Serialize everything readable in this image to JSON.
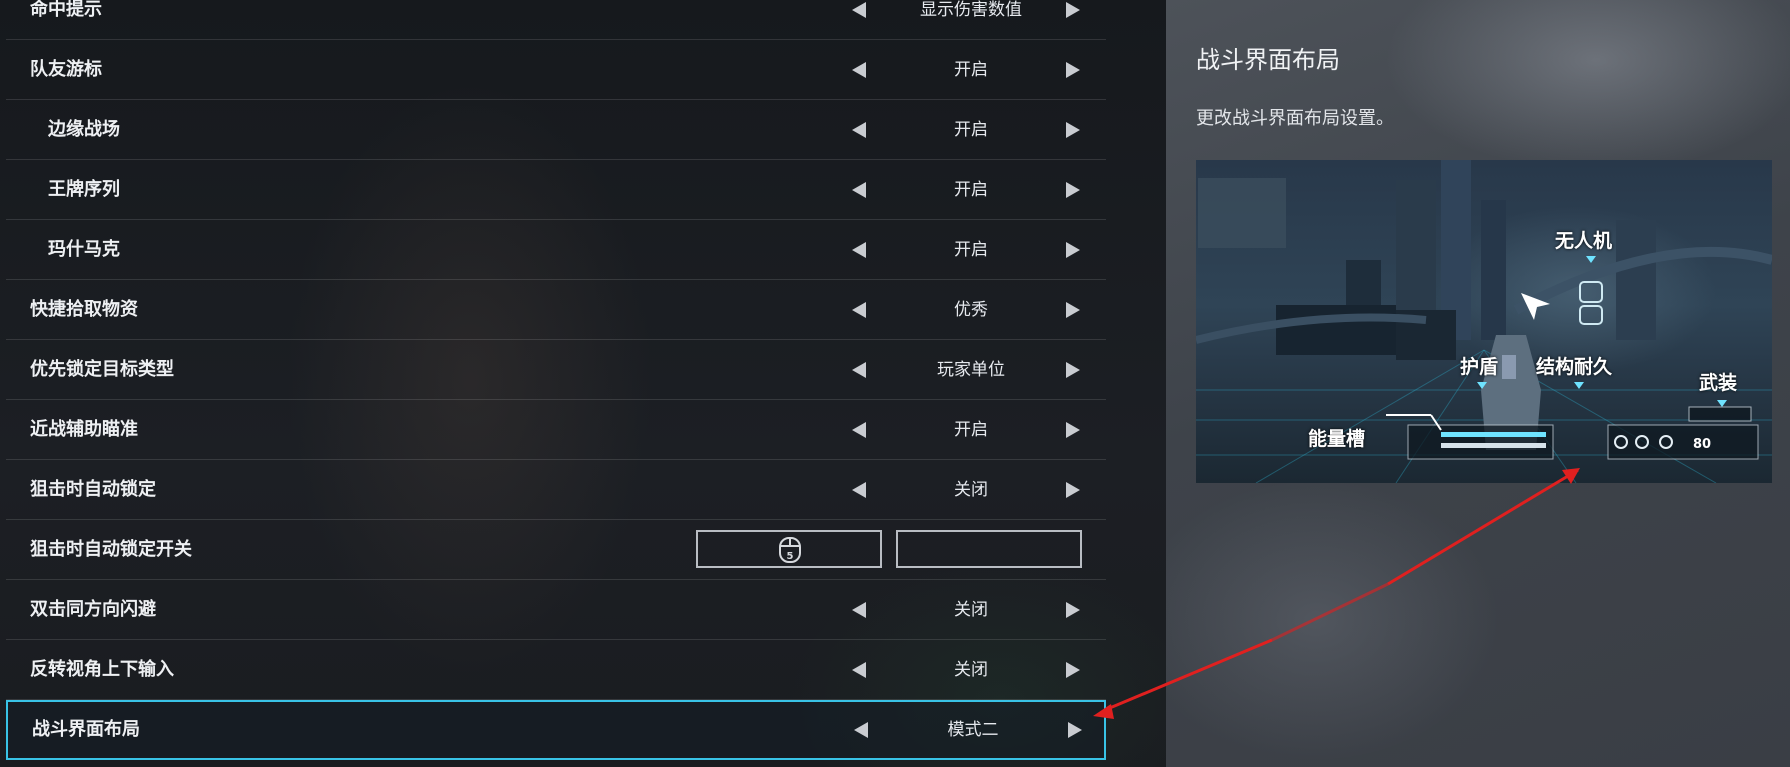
{
  "settings": {
    "rows": [
      {
        "label": "命中提示",
        "value": "显示伤害数值"
      },
      {
        "label": "队友游标",
        "value": "开启"
      },
      {
        "label": "边缘战场",
        "value": "开启"
      },
      {
        "label": "王牌序列",
        "value": "开启"
      },
      {
        "label": "玛什马克",
        "value": "开启"
      },
      {
        "label": "快捷拾取物资",
        "value": "优秀"
      },
      {
        "label": "优先锁定目标类型",
        "value": "玩家单位"
      },
      {
        "label": "近战辅助瞄准",
        "value": "开启"
      },
      {
        "label": "狙击时自动锁定",
        "value": "关闭"
      },
      {
        "label": "狙击时自动锁定开关",
        "key1": "5",
        "key2": ""
      },
      {
        "label": "双击同方向闪避",
        "value": "关闭"
      },
      {
        "label": "反转视角上下输入",
        "value": "关闭"
      },
      {
        "label": "战斗界面布局",
        "value": "模式二"
      }
    ]
  },
  "panel": {
    "title": "战斗界面布局",
    "description": "更改战斗界面布局设置。"
  },
  "preview": {
    "labels": {
      "drone": "无人机",
      "shield": "护盾",
      "durability": "结构耐久",
      "weapon": "武装",
      "energy": "能量槽"
    },
    "ammo": "80"
  },
  "colors": {
    "accent": "#39c3e6",
    "annotation": "#e0201f"
  }
}
